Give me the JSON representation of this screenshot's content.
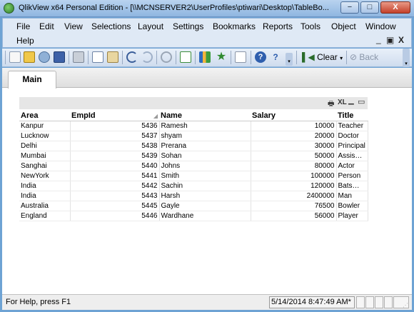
{
  "window": {
    "title": "QlikView x64 Personal Edition - [\\\\MCNSERVER2\\UserProfiles\\ptiwari\\Desktop\\TableBo...",
    "minimize": "−",
    "maximize": "□",
    "close": "X"
  },
  "menu": {
    "items": [
      "File",
      "Edit",
      "View",
      "Selections",
      "Layout",
      "Settings",
      "Bookmarks",
      "Reports",
      "Tools",
      "Object",
      "Window",
      "Help"
    ],
    "mdi_minimize": "_",
    "mdi_restore": "▣",
    "mdi_close": "X"
  },
  "toolbar": {
    "clear_label": "Clear",
    "back_label": "Back"
  },
  "tabs": [
    {
      "label": "Main"
    }
  ],
  "table": {
    "caption_icons": [
      "print",
      "XL",
      "_",
      "□"
    ],
    "xl_label": "XL",
    "columns": [
      "Area",
      "EmpId",
      "Name",
      "Salary",
      "Title"
    ],
    "rows": [
      [
        "Kanpur",
        "5436",
        "Ramesh",
        "10000",
        "Teacher"
      ],
      [
        "Lucknow",
        "5437",
        "shyam",
        "20000",
        "Doctor"
      ],
      [
        "Delhi",
        "5438",
        "Prerana",
        "30000",
        "Principal"
      ],
      [
        "Mumbai",
        "5439",
        "Sohan",
        "50000",
        "Assis…"
      ],
      [
        "Sanghai",
        "5440",
        "Johns",
        "80000",
        "Actor"
      ],
      [
        "NewYork",
        "5441",
        "Smith",
        "100000",
        "Person"
      ],
      [
        "India",
        "5442",
        "Sachin",
        "120000",
        "Bats…"
      ],
      [
        "India",
        "5443",
        "Harsh",
        "2400000",
        "Man"
      ],
      [
        "Australia",
        "5445",
        "Gayle",
        "76500",
        "Bowler"
      ],
      [
        "England",
        "5446",
        "Wardhane",
        "56000",
        "Player"
      ]
    ]
  },
  "status": {
    "help_text": "For Help, press F1",
    "timestamp": "5/14/2014 8:47:49 AM*"
  }
}
